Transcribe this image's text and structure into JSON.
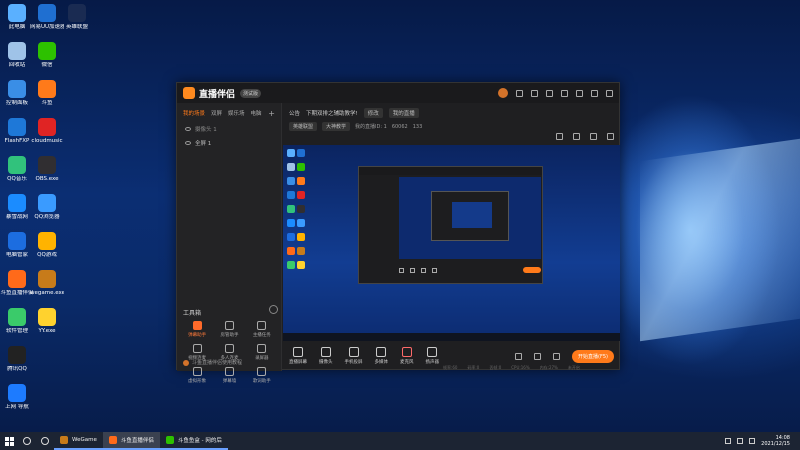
{
  "desktop": {
    "icons": [
      {
        "label": "此电脑",
        "color": "#5ab0ff"
      },
      {
        "label": "网易UU加速器",
        "color": "#1f6fd1"
      },
      {
        "label": "英雄联盟",
        "color": "#1a2b52"
      },
      {
        "label": "回收站",
        "color": "#9fc3e8"
      },
      {
        "label": "微信",
        "color": "#2dc100"
      },
      {
        "label": "控制面板",
        "color": "#3a8ee6"
      },
      {
        "label": "斗鱼",
        "color": "#ff7a1a"
      },
      {
        "label": "FlashFXP",
        "color": "#1e78d8"
      },
      {
        "label": "cloudmusic",
        "color": "#e02424"
      },
      {
        "label": "QQ音乐",
        "color": "#31c27c"
      },
      {
        "label": "OBS.exe",
        "color": "#302e31"
      },
      {
        "label": "暴雪战网",
        "color": "#1b8cff"
      },
      {
        "label": "QQ浏览器",
        "color": "#3a9bff"
      },
      {
        "label": "电脑管家",
        "color": "#1c6de0"
      },
      {
        "label": "QQ游戏",
        "color": "#ffb300"
      },
      {
        "label": "斗鱼直播伴侣",
        "color": "#ff6a1a"
      },
      {
        "label": "wegame.exe",
        "color": "#c77b1a"
      },
      {
        "label": "软件管理",
        "color": "#3acb6a"
      },
      {
        "label": "YY.exe",
        "color": "#ffd22e"
      },
      {
        "label": "腾讯QQ",
        "color": "#222222"
      },
      {
        "label": "上网 导航",
        "color": "#1d7bff"
      }
    ]
  },
  "app": {
    "title": "直播伴侣",
    "version": "测试版",
    "scene_tabs": [
      "我的场景",
      "双屏",
      "娱乐场",
      "电脑"
    ],
    "source_rows": [
      "摄像头 1",
      "全屏 1"
    ],
    "announcement_label": "公告",
    "announcement": "下期双排之辅助教学!",
    "edit_label": "修改",
    "category": "我的直播",
    "tags": [
      "英雄联盟",
      "大神教学"
    ],
    "room_label": "我的直播ID: 1",
    "viewers": "60062",
    "likes": "133",
    "toolbox_title": "工具箱",
    "tools": [
      {
        "label": "弹幕助手",
        "hot": true
      },
      {
        "label": "房管助手",
        "hot": false
      },
      {
        "label": "主播任务",
        "hot": false
      },
      {
        "label": "视频连麦",
        "hot": false
      },
      {
        "label": "多人连麦",
        "hot": false
      },
      {
        "label": "录屏器",
        "hot": false
      },
      {
        "label": "虚拟形象",
        "hot": false
      },
      {
        "label": "弹幕墙",
        "hot": false
      },
      {
        "label": "歌词助手",
        "hot": false
      }
    ],
    "room_footer": "斗鱼直播伴侣使用教程",
    "bottom_buttons": [
      "直播屏幕",
      "摄像头",
      "手机投屏",
      "多媒体",
      "麦克风",
      "扬声器"
    ],
    "start_button": "开始直播(F5)",
    "stats": [
      "帧率:60",
      "码率:0",
      "丢帧:0",
      "CPU:16%",
      "内存:27%",
      "未开启"
    ]
  },
  "taskbar": {
    "apps": [
      {
        "label": "WeGame",
        "color": "#c77b1a",
        "active": false
      },
      {
        "label": "斗鱼直播伴侣",
        "color": "#ff6a1a",
        "active": true
      },
      {
        "label": "斗鱼鱼盒 - 网的后",
        "color": "#2dc100",
        "active": false
      }
    ],
    "time": "14:08",
    "date": "2021/12/15"
  }
}
